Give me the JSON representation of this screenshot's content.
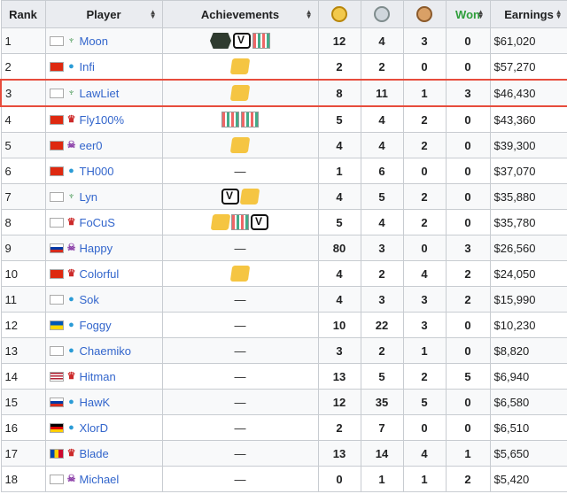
{
  "headers": {
    "rank": "Rank",
    "player": "Player",
    "achievements": "Achievements",
    "won": "Won",
    "earnings": "Earnings",
    "gold_icon": "gold-medal-icon",
    "silver_icon": "silver-medal-icon",
    "bronze_icon": "bronze-medal-icon"
  },
  "colors": {
    "highlight": "#e74c3c",
    "won_header": "#2e9e3b",
    "link": "#3366cc"
  },
  "rows": [
    {
      "rank": "1",
      "flag": "kr",
      "race": "r",
      "name": "Moon",
      "ach": [
        "hex",
        "black",
        "stripe"
      ],
      "gold": "12",
      "silver": "4",
      "bronze": "3",
      "won": "0",
      "earnings": "$61,020"
    },
    {
      "rank": "2",
      "flag": "cn",
      "race": "p",
      "name": "Infi",
      "ach": [
        "gold"
      ],
      "gold": "2",
      "silver": "2",
      "bronze": "0",
      "won": "0",
      "earnings": "$57,270"
    },
    {
      "rank": "3",
      "flag": "kr",
      "race": "r",
      "name": "LawLiet",
      "ach": [
        "gold"
      ],
      "gold": "8",
      "silver": "11",
      "bronze": "1",
      "won": "3",
      "earnings": "$46,430"
    },
    {
      "rank": "4",
      "flag": "cn",
      "race": "t",
      "name": "Fly100%",
      "ach": [
        "stripe",
        "stripe"
      ],
      "gold": "5",
      "silver": "4",
      "bronze": "2",
      "won": "0",
      "earnings": "$43,360"
    },
    {
      "rank": "5",
      "flag": "cn",
      "race": "z",
      "name": "eer0",
      "ach": [
        "gold"
      ],
      "gold": "4",
      "silver": "4",
      "bronze": "2",
      "won": "0",
      "earnings": "$39,300"
    },
    {
      "rank": "6",
      "flag": "cn",
      "race": "p",
      "name": "TH000",
      "ach": [],
      "gold": "1",
      "silver": "6",
      "bronze": "0",
      "won": "0",
      "earnings": "$37,070"
    },
    {
      "rank": "7",
      "flag": "kr",
      "race": "r",
      "name": "Lyn",
      "ach": [
        "black",
        "gold"
      ],
      "gold": "4",
      "silver": "5",
      "bronze": "2",
      "won": "0",
      "earnings": "$35,880"
    },
    {
      "rank": "8",
      "flag": "kr",
      "race": "t",
      "name": "FoCuS",
      "ach": [
        "gold",
        "stripe",
        "black"
      ],
      "gold": "5",
      "silver": "4",
      "bronze": "2",
      "won": "0",
      "earnings": "$35,780"
    },
    {
      "rank": "9",
      "flag": "ru",
      "race": "z",
      "name": "Happy",
      "ach": [],
      "gold": "80",
      "silver": "3",
      "bronze": "0",
      "won": "3",
      "earnings": "$26,560"
    },
    {
      "rank": "10",
      "flag": "cn",
      "race": "t",
      "name": "Colorful",
      "ach": [
        "gold"
      ],
      "gold": "4",
      "silver": "2",
      "bronze": "4",
      "won": "2",
      "earnings": "$24,050"
    },
    {
      "rank": "11",
      "flag": "kr",
      "race": "p",
      "name": "Sok",
      "ach": [],
      "gold": "4",
      "silver": "3",
      "bronze": "3",
      "won": "2",
      "earnings": "$15,990"
    },
    {
      "rank": "12",
      "flag": "ua",
      "race": "p",
      "name": "Foggy",
      "ach": [],
      "gold": "10",
      "silver": "22",
      "bronze": "3",
      "won": "0",
      "earnings": "$10,230"
    },
    {
      "rank": "13",
      "flag": "kr",
      "race": "p",
      "name": "Chaemiko",
      "ach": [],
      "gold": "3",
      "silver": "2",
      "bronze": "1",
      "won": "0",
      "earnings": "$8,820"
    },
    {
      "rank": "14",
      "flag": "us",
      "race": "t",
      "name": "Hitman",
      "ach": [],
      "gold": "13",
      "silver": "5",
      "bronze": "2",
      "won": "5",
      "earnings": "$6,940"
    },
    {
      "rank": "15",
      "flag": "ru",
      "race": "p",
      "name": "HawK",
      "ach": [],
      "gold": "12",
      "silver": "35",
      "bronze": "5",
      "won": "0",
      "earnings": "$6,580"
    },
    {
      "rank": "16",
      "flag": "de",
      "race": "p",
      "name": "XlorD",
      "ach": [],
      "gold": "2",
      "silver": "7",
      "bronze": "0",
      "won": "0",
      "earnings": "$6,510"
    },
    {
      "rank": "17",
      "flag": "md",
      "race": "t",
      "name": "Blade",
      "ach": [],
      "gold": "13",
      "silver": "14",
      "bronze": "4",
      "won": "1",
      "earnings": "$5,650"
    },
    {
      "rank": "18",
      "flag": "kr",
      "race": "z",
      "name": "Michael",
      "ach": [],
      "gold": "0",
      "silver": "1",
      "bronze": "1",
      "won": "2",
      "earnings": "$5,420"
    }
  ]
}
